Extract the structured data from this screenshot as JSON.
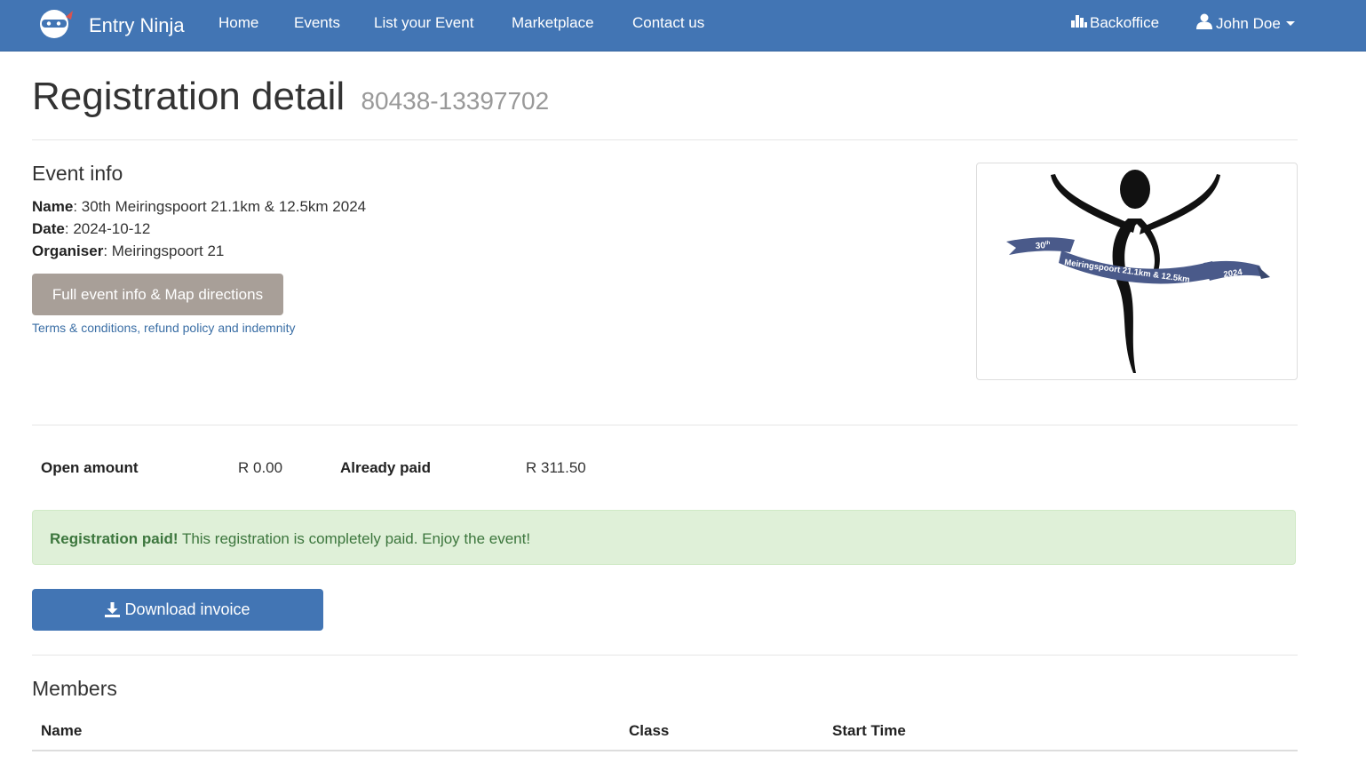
{
  "navbar": {
    "brand": "Entry Ninja",
    "links": [
      "Home",
      "Events",
      "List your Event",
      "Marketplace",
      "Contact us"
    ],
    "backoffice": "Backoffice",
    "user": "John Doe"
  },
  "page": {
    "title": "Registration detail",
    "reference": "80438-13397702"
  },
  "event_info": {
    "heading": "Event info",
    "name_label": "Name",
    "name_value": "30th Meiringspoort 21.1km & 12.5km 2024",
    "date_label": "Date",
    "date_value": "2024-10-12",
    "organiser_label": "Organiser",
    "organiser_value": "Meiringspoort 21",
    "info_button": "Full event info & Map directions",
    "terms_link": "Terms & conditions, refund policy and indemnity",
    "logo": {
      "number": "30",
      "suffix": "th",
      "ribbon_text": "Meiringspoort 21.1km & 12.5km",
      "year": "2024"
    }
  },
  "payment": {
    "open_label": "Open amount",
    "open_value": "R 0.00",
    "paid_label": "Already paid",
    "paid_value": "R 311.50"
  },
  "alert": {
    "strong": "Registration paid!",
    "message": "This registration is completely paid. Enjoy the event!"
  },
  "download_button": "Download invoice",
  "members": {
    "heading": "Members",
    "columns": [
      "Name",
      "Class",
      "Start Time"
    ]
  },
  "colors": {
    "primary": "#4275b4",
    "success_bg": "#dff0d8",
    "success_text": "#3c763d",
    "grey_button": "#a89f98",
    "ribbon": "#4a5a8a"
  }
}
